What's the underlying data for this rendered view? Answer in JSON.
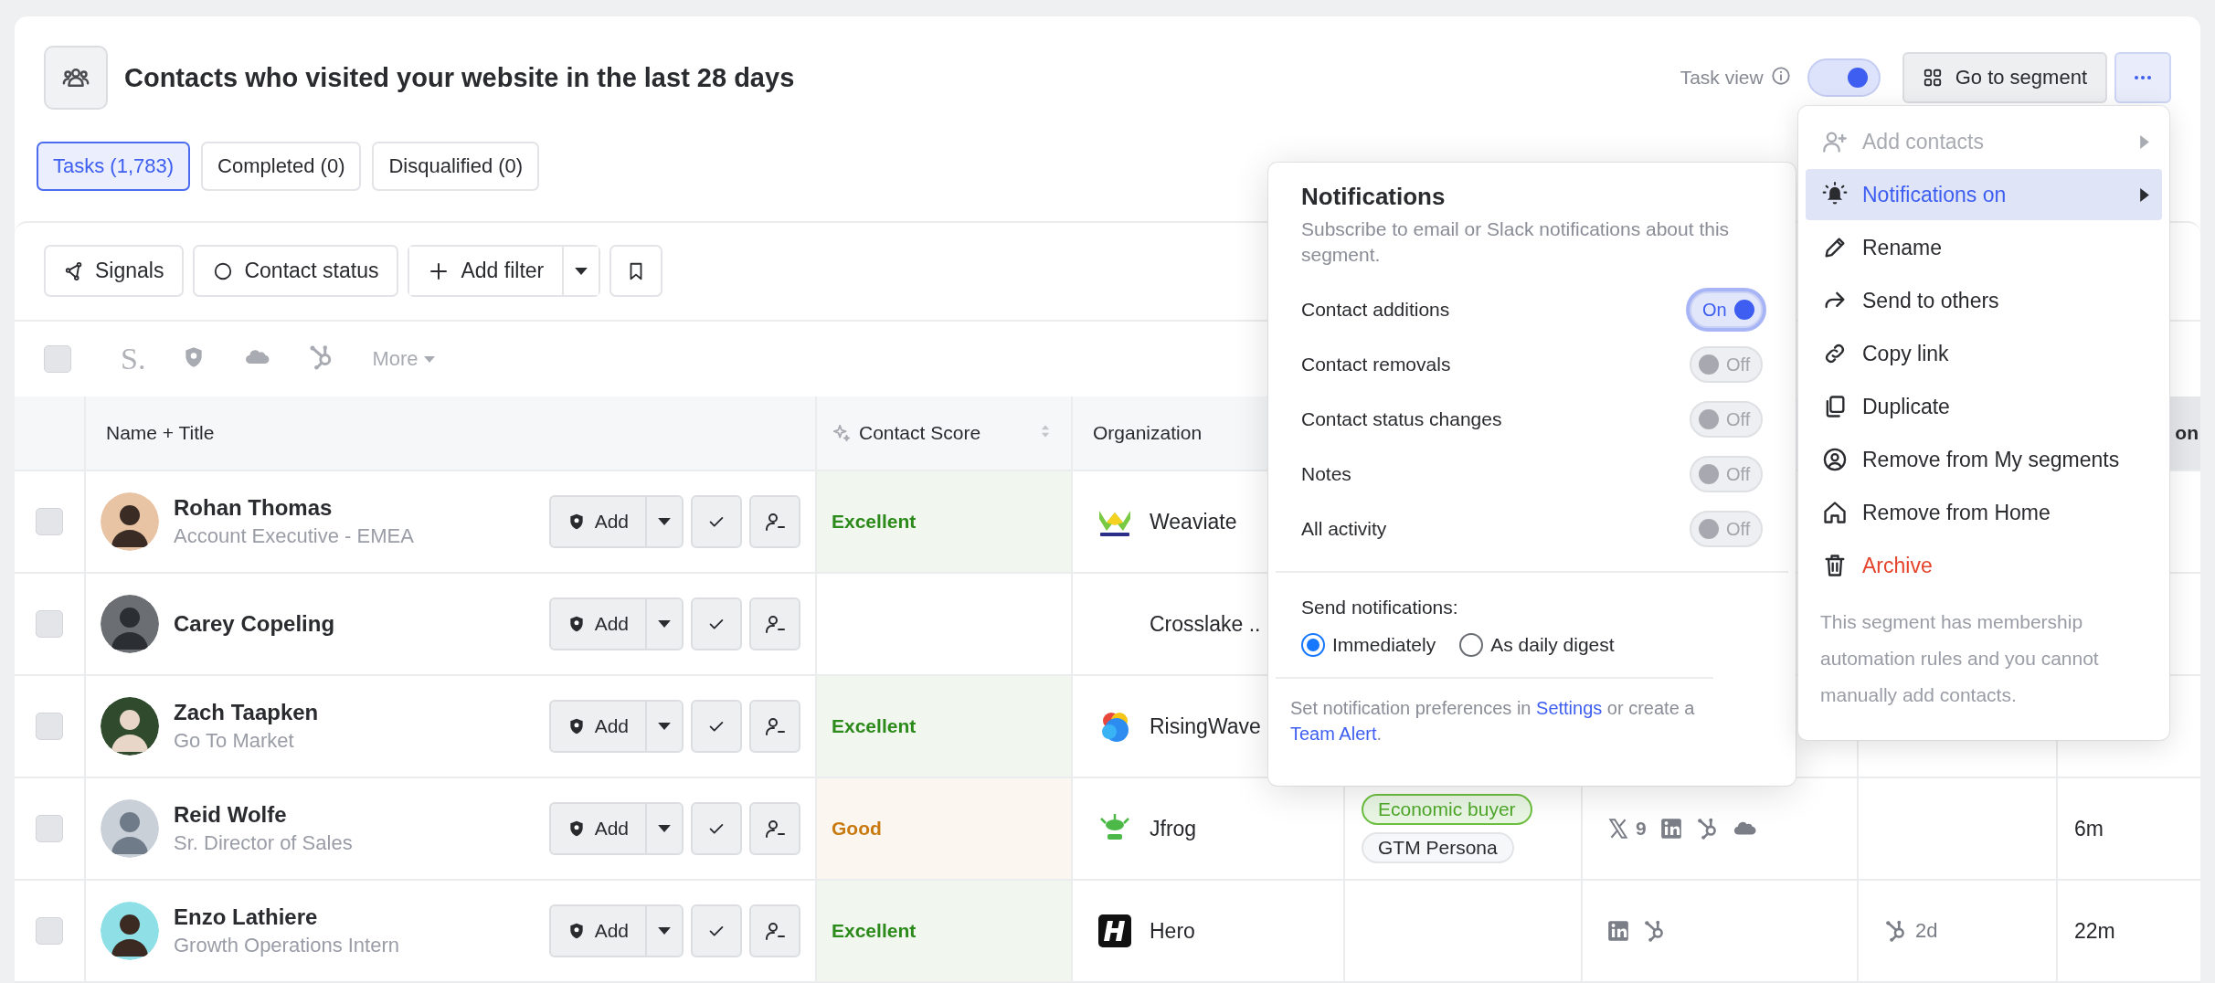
{
  "header": {
    "title": "Contacts who visited your website in the last 28 days",
    "task_view": {
      "label": "Task view",
      "on": true
    },
    "go_to_segment": "Go to segment"
  },
  "tabs": [
    {
      "label": "Tasks (1,783)",
      "selected": true
    },
    {
      "label": "Completed (0)",
      "selected": false
    },
    {
      "label": "Disqualified (0)",
      "selected": false
    }
  ],
  "filters": {
    "buttons": [
      "Signals",
      "Contact status"
    ],
    "add_filter": "Add filter"
  },
  "integrations": {
    "select_all_checked": false,
    "logo_text": "S.",
    "more": "More"
  },
  "table": {
    "columns": {
      "name": "Name + Title",
      "score": "Contact Score",
      "organization": "Organization",
      "column_8": "on"
    },
    "rows": [
      {
        "name": "Rohan Thomas",
        "title": "Account Executive - EMEA",
        "checked": false,
        "add_label": "Add",
        "score": {
          "label": "Excellent",
          "kind": "excellent"
        },
        "organization": {
          "name": "Weaviate",
          "logo": true
        }
      },
      {
        "name": "Carey Copeling",
        "checked": false,
        "add_label": "Add",
        "organization": {
          "name": "Crosslake ..",
          "logo": false
        }
      },
      {
        "name": "Zach Taapken",
        "title": "Go To Market",
        "checked": false,
        "add_label": "Add",
        "score": {
          "label": "Excellent",
          "kind": "excellent"
        },
        "organization": {
          "name": "RisingWave",
          "logo": true
        }
      },
      {
        "name": "Reid Wolfe",
        "title": "Sr. Director of Sales",
        "checked": false,
        "add_label": "Add",
        "score": {
          "label": "Good",
          "kind": "good"
        },
        "organization": {
          "name": "Jfrog",
          "logo": true
        },
        "tags": [
          {
            "label": "Economic buyer",
            "kind": "buyer"
          },
          {
            "label": "GTM Persona",
            "kind": "persona"
          }
        ],
        "signals": [
          {
            "kind": "x",
            "count": "9"
          },
          {
            "kind": "linkedin"
          },
          {
            "kind": "hubspot"
          },
          {
            "kind": "salesforce"
          }
        ],
        "column_8": "6m"
      },
      {
        "name": "Enzo Lathiere",
        "title": "Growth Operations Intern",
        "checked": false,
        "add_label": "Add",
        "score": {
          "label": "Excellent",
          "kind": "excellent"
        },
        "organization": {
          "name": "Hero",
          "logo": true
        },
        "signals": [
          {
            "kind": "linkedin"
          },
          {
            "kind": "hubspot"
          }
        ],
        "column_7": {
          "kind": "hubspot",
          "text": "2d"
        },
        "column_8": "22m"
      }
    ]
  },
  "notifications": {
    "title": "Notifications",
    "subtitle": "Subscribe to email or Slack notifications about this segment.",
    "toggles": [
      {
        "label": "Contact additions",
        "on": true,
        "state_text": "On",
        "focused": true
      },
      {
        "label": "Contact removals",
        "on": false,
        "state_text": "Off",
        "focused": false
      },
      {
        "label": "Contact status changes",
        "on": false,
        "state_text": "Off",
        "focused": false
      },
      {
        "label": "Notes",
        "on": false,
        "state_text": "Off",
        "focused": false
      },
      {
        "label": "All activity",
        "on": false,
        "state_text": "Off",
        "focused": false
      }
    ],
    "send_label": "Send notifications:",
    "options": [
      {
        "label": "Immediately",
        "selected": true
      },
      {
        "label": "As daily digest",
        "selected": false
      }
    ],
    "footer": {
      "text_1": "Set notification preferences in ",
      "link_1": "Settings",
      "text_2": " or create a ",
      "link_2": "Team Alert",
      "text_3": "."
    }
  },
  "menu": {
    "items": [
      {
        "label": "Add contacts",
        "disabled": true,
        "selected": false,
        "submenu": true,
        "danger": false
      },
      {
        "label": "Notifications on",
        "disabled": false,
        "selected": true,
        "submenu": true,
        "danger": false
      },
      {
        "label": "Rename",
        "disabled": false,
        "selected": false,
        "submenu": false,
        "danger": false
      },
      {
        "label": "Send to others",
        "disabled": false,
        "selected": false,
        "submenu": false,
        "danger": false
      },
      {
        "label": "Copy link",
        "disabled": false,
        "selected": false,
        "submenu": false,
        "danger": false
      },
      {
        "label": "Duplicate",
        "disabled": false,
        "selected": false,
        "submenu": false,
        "danger": false
      },
      {
        "label": "Remove from My segments",
        "disabled": false,
        "selected": false,
        "submenu": false,
        "danger": false
      },
      {
        "label": "Remove from Home",
        "disabled": false,
        "selected": false,
        "submenu": false,
        "danger": false
      },
      {
        "label": "Archive",
        "disabled": false,
        "selected": false,
        "submenu": false,
        "danger": true
      }
    ],
    "note": "This segment has membership automation rules and you cannot manually add contacts."
  }
}
